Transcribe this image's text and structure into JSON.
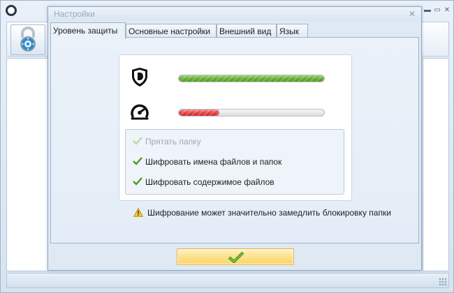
{
  "dialog": {
    "title": "Настройки",
    "close_glyph": "✕"
  },
  "tabs": [
    {
      "label": "Уровень защиты",
      "active": true
    },
    {
      "label": "Основные настройки",
      "active": false
    },
    {
      "label": "Внешний вид",
      "active": false
    },
    {
      "label": "Язык",
      "active": false
    }
  ],
  "protection": {
    "security_level": 1.0,
    "speed_level": 0.28,
    "security_icon": "shield-icon",
    "speed_icon": "speedometer-icon"
  },
  "options": [
    {
      "label": "Прятать папку",
      "checked": true,
      "enabled": false
    },
    {
      "label": "Шифровать имена файлов и папок",
      "checked": true,
      "enabled": true
    },
    {
      "label": "Шифровать содержимое файлов",
      "checked": true,
      "enabled": true
    }
  ],
  "warning": {
    "text": "Шифрование может значительно замедлить блокировку папки",
    "icon": "warning-icon"
  },
  "ok_button": {
    "icon": "checkmark-icon"
  },
  "colors": {
    "security_bar": "#5fa92f",
    "speed_bar": "#e03b3b",
    "ok_button": "#fde18a"
  }
}
